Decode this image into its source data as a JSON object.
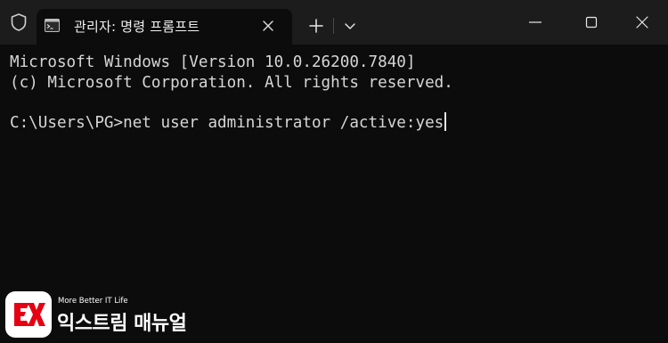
{
  "titlebar": {
    "tab_title": "관리자: 명령 프롬프트",
    "icons": {
      "shield": "shield-icon",
      "tab": "command-prompt-icon",
      "close_tab": "close-icon",
      "new_tab": "plus-icon",
      "dropdown": "chevron-down-icon",
      "minimize": "minimize-icon",
      "maximize": "maximize-icon",
      "close_window": "close-icon"
    }
  },
  "terminal": {
    "line1": "Microsoft Windows [Version 10.0.26200.7840]",
    "line2": "(c) Microsoft Corporation. All rights reserved.",
    "prompt": "C:\\Users\\PG>",
    "command": "net user administrator /active:yes"
  },
  "watermark": {
    "tagline": "More Better IT Life",
    "name": "익스트림 매뉴얼",
    "logo": "ex-logo"
  },
  "colors": {
    "titlebar_bg": "#1c1c1c",
    "terminal_bg": "#0c0c0c",
    "text": "#d6d6d6",
    "logo_red": "#e60012"
  }
}
